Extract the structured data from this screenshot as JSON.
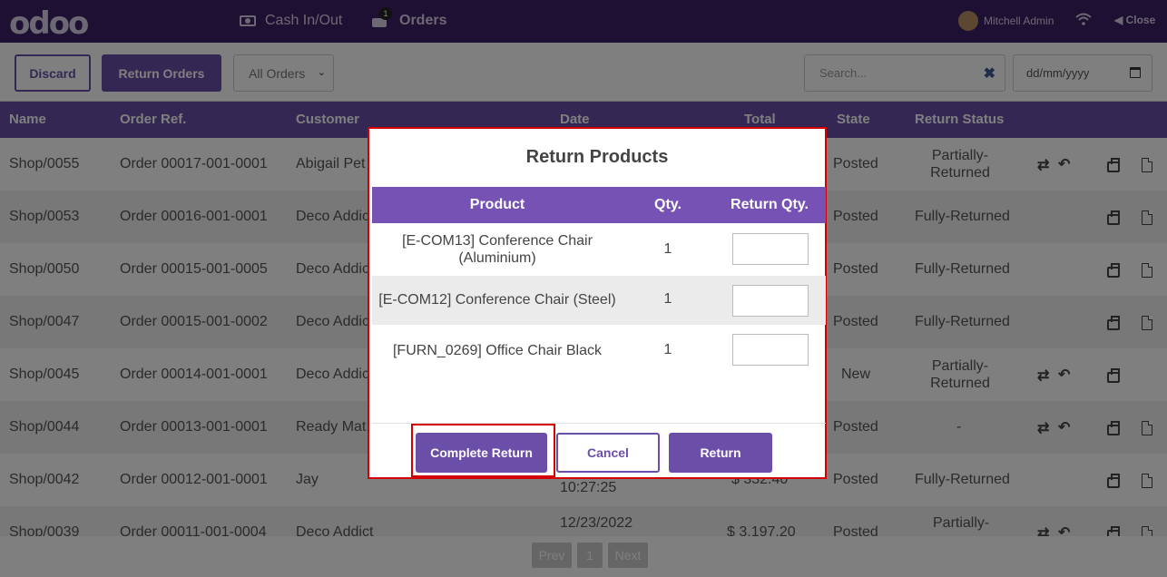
{
  "topbar": {
    "logo": "odoo",
    "cash_label": "Cash In/Out",
    "orders_label": "Orders",
    "orders_badge": "1",
    "user_name": "Mitchell Admin",
    "close_label": "Close"
  },
  "controls": {
    "discard_label": "Discard",
    "return_orders_label": "Return Orders",
    "filter_value": "All Orders",
    "search_placeholder": "Search...",
    "date_placeholder": "dd/mm/yyyy"
  },
  "table": {
    "headers": [
      "Name",
      "Order Ref.",
      "Customer",
      "Date",
      "Total",
      "State",
      "Return Status"
    ],
    "rows": [
      {
        "name": "Shop/0055",
        "ref": "Order 00017-001-0001",
        "customer": "Abigail Pet",
        "state": "Posted",
        "status_l1": "Partially-",
        "status_l2": "Returned"
      },
      {
        "name": "Shop/0053",
        "ref": "Order 00016-001-0001",
        "customer": "Deco Addic",
        "state": "Posted",
        "status": "Fully-Returned"
      },
      {
        "name": "Shop/0050",
        "ref": "Order 00015-001-0005",
        "customer": "Deco Addic",
        "state": "Posted",
        "status": "Fully-Returned"
      },
      {
        "name": "Shop/0047",
        "ref": "Order 00015-001-0002",
        "customer": "Deco Addic",
        "state": "Posted",
        "status": "Fully-Returned"
      },
      {
        "name": "Shop/0045",
        "ref": "Order 00014-001-0001",
        "customer": "Deco Addic",
        "state": "New",
        "status_l1": "Partially-",
        "status_l2": "Returned"
      },
      {
        "name": "Shop/0044",
        "ref": "Order 00013-001-0001",
        "customer": "Ready Mat,",
        "state": "Posted",
        "status": "-"
      },
      {
        "name": "Shop/0042",
        "ref": "Order 00012-001-0001",
        "customer": "Jay",
        "date_time": "10:27:25",
        "total": "$ 332.40",
        "state": "Posted",
        "status": "Fully-Returned"
      },
      {
        "name": "Shop/0039",
        "ref": "Order 00011-001-0004",
        "customer": "Deco Addict",
        "date": "12/23/2022",
        "total": "$ 3,197.20",
        "state": "Posted",
        "status_l1": "Partially-"
      }
    ]
  },
  "pager": {
    "prev": "Prev",
    "page": "1",
    "next": "Next"
  },
  "modal": {
    "title": "Return Products",
    "headers": {
      "product": "Product",
      "qty": "Qty.",
      "return_qty": "Return Qty."
    },
    "rows": [
      {
        "product_l1": "[E-COM13] Conference Chair",
        "product_l2": "(Aluminium)",
        "qty": "1"
      },
      {
        "product": "[E-COM12] Conference Chair (Steel)",
        "qty": "1"
      },
      {
        "product": "[FURN_0269] Office Chair Black",
        "qty": "1"
      }
    ],
    "complete_label": "Complete Return",
    "cancel_label": "Cancel",
    "return_label": "Return"
  }
}
